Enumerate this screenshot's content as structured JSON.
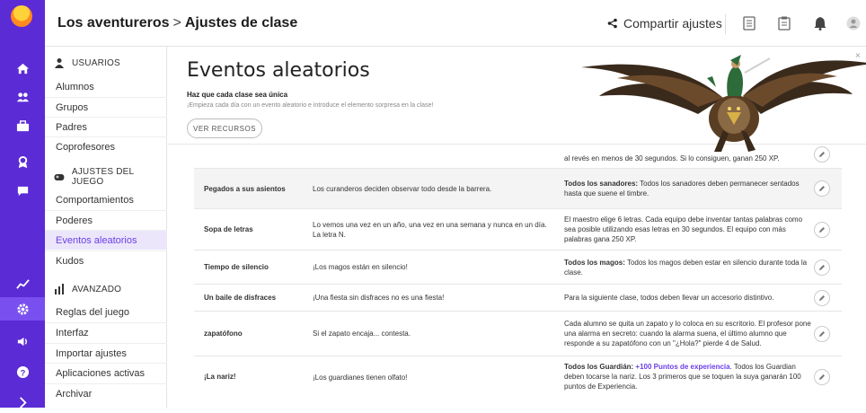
{
  "header": {
    "breadcrumb_class": "Los aventureros",
    "breadcrumb_sep": ">",
    "breadcrumb_page": "Ajustes de clase",
    "share_label": "Compartir ajustes"
  },
  "sidebar": {
    "users_section": "USUARIOS",
    "users_items": [
      "Alumnos",
      "Grupos",
      "Padres",
      "Coprofesores"
    ],
    "game_section": "AJUSTES DEL JUEGO",
    "game_items": [
      "Comportamientos",
      "Poderes",
      "Eventos aleatorios",
      "Kudos"
    ],
    "advanced_section": "AVANZADO",
    "advanced_items": [
      "Reglas del juego",
      "Interfaz",
      "Importar ajustes",
      "Aplicaciones activas",
      "Archivar"
    ],
    "selected": "Eventos aleatorios"
  },
  "page": {
    "title": "Eventos aleatorios",
    "subtitle": "Haz que cada clase sea única",
    "description": "¡Empieza cada día con un evento aleatorio e introduce el elemento sorpresa en la clase!",
    "resources_button": "VER RECURSOS",
    "close_label": "×"
  },
  "events": [
    {
      "name": "",
      "description": "",
      "effect": "al revés en menos de 30 segundos. Si lo consiguen, ganan 250 XP."
    },
    {
      "name": "Pegados a sus asientos",
      "description": "Los curanderos deciden observar todo desde la barrera.",
      "effect_bold": "Todos los sanadores:",
      "effect": " Todos los sanadores deben permanecer sentados hasta que suene el timbre."
    },
    {
      "name": "Sopa de letras",
      "description": "Lo vemos una vez en un año, una vez en una semana y nunca en un día. La letra N.",
      "effect": "El maestro elige 6 letras. Cada equipo debe inventar tantas palabras como sea posible utilizando esas letras en 30 segundos. El equipo con más palabras gana 250 XP."
    },
    {
      "name": "Tiempo de silencio",
      "description": "¡Los magos están en silencio!",
      "effect_bold": "Todos los magos:",
      "effect": " Todos los magos deben estar en silencio durante toda la clase."
    },
    {
      "name": "Un baile de disfraces",
      "description": "¡Una fiesta sin disfraces no es una fiesta!",
      "effect": "Para la siguiente clase, todos deben llevar un accesorio distintivo."
    },
    {
      "name": "zapatófono",
      "description": "Si el zapato encaja... contesta.",
      "effect": "Cada alumno se quita un zapato y lo coloca en su escritorio. El profesor pone una alarma en secreto: cuando la alarma suena, el último alumno que responde a su zapatófono con un \"¿Hola?\" pierde 4 de Salud."
    },
    {
      "name": "¡La nariz!",
      "description": "¡Los guardianes tienen olfato!",
      "effect_bold": "Todos los Guardián:",
      "effect_bonus": " +100 Puntos de experiencia",
      "effect": ". Todos los Guardian deben tocarse la nariz. Los 3 primeros que se toquen la suya ganarán 100 puntos de Experiencia."
    }
  ],
  "colors": {
    "rail": "#5b2bd6",
    "accent": "#6a3ee8",
    "selected_bg": "#ece6fb"
  }
}
